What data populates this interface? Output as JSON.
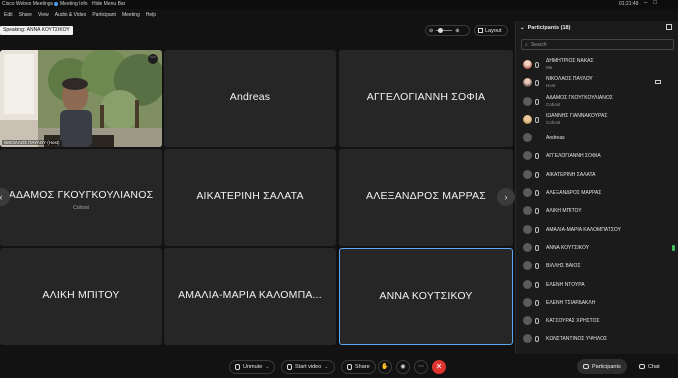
{
  "titlebar": {
    "app_title": "Cisco Webex Meetings",
    "meeting_info": "Meeting Info",
    "hide_menu": "Hide Menu Bar",
    "clock": "01:21:49"
  },
  "menu": [
    "Edit",
    "Share",
    "View",
    "Audio & Video",
    "Participant",
    "Meeting",
    "Help"
  ],
  "speaking_label": "Speaking: ΑΝΝΑ ΚΟΥΤΣΙΚΟΥ",
  "layout_label": "Layout",
  "tiles": [
    {
      "name": "ΝΙΚΟΛΑΟΣ ΠΑΥΛΟΥ (Host)",
      "role": ""
    },
    {
      "name": "Andreas",
      "role": ""
    },
    {
      "name": "ΑΓΓΕΛΟΓΙΑΝΝΗ ΣΟΦΙΑ",
      "role": ""
    },
    {
      "name": "ΑΔΑΜΟΣ ΓΚΟΥΓΚΟΥΛΙΑΝΟΣ",
      "role": "Cohost"
    },
    {
      "name": "ΑΙΚΑΤΕΡΙΝΗ ΣΑΛΑΤΑ",
      "role": ""
    },
    {
      "name": "ΑΛΕΞΑΝΔΡΟΣ ΜΑΡΡΑΣ",
      "role": ""
    },
    {
      "name": "ΑΛΙΚΗ ΜΠΙΤΟΥ",
      "role": ""
    },
    {
      "name": "ΑΜΑΛΙΑ-ΜΑΡΙΑ ΚΑΛΟΜΠΑ...",
      "role": ""
    },
    {
      "name": "ΑΝΝΑ ΚΟΥΤΣΙΚΟΥ",
      "role": ""
    }
  ],
  "participants_panel": {
    "title": "Participants (18)",
    "search_placeholder": "Search",
    "items": [
      {
        "name": "ΔΗΜΗΤΡΙΟΣ ΝΑΚΑΣ",
        "sub": "Me"
      },
      {
        "name": "ΝΙΚΟΛΑΟΣ ΠΑΥΛΟΥ",
        "sub": "Host"
      },
      {
        "name": "ΑΔΑΜΟΣ ΓΚΟΥΓΚΟΥΛΙΑΝΟΣ",
        "sub": "Cohost"
      },
      {
        "name": "ΙΩΑΝΝΗΣ ΓΙΑΝΝΑΚΟΥΡΑΣ",
        "sub": "Cohost"
      },
      {
        "name": "Andreas",
        "sub": ""
      },
      {
        "name": "ΑΓΓΕΛΟΓΙΑΝΝΗ ΣΟΦΙΑ",
        "sub": ""
      },
      {
        "name": "ΑΙΚΑΤΕΡΙΝΗ ΣΑΛΑΤΑ",
        "sub": ""
      },
      {
        "name": "ΑΛΕΞΑΝΔΡΟΣ ΜΑΡΡΑΣ",
        "sub": ""
      },
      {
        "name": "ΑΛΙΚΗ ΜΠΙΤΟΥ",
        "sub": ""
      },
      {
        "name": "ΑΜΑΛΙΑ-ΜΑΡΙΑ ΚΑΛΟΜΠΑΤΣΟΥ",
        "sub": ""
      },
      {
        "name": "ΑΝΝΑ ΚΟΥΤΣΙΚΟΥ",
        "sub": ""
      },
      {
        "name": "ΒΙΛΛΗΣ ΒΑΙΟΣ",
        "sub": ""
      },
      {
        "name": "ΕΛΕΝΗ ΝΤΟΥΡΑ",
        "sub": ""
      },
      {
        "name": "ΕΛΕΝΗ ΤΣΙΑΡΔΑΚΛΗ",
        "sub": ""
      },
      {
        "name": "ΚΑΤΣΟΥΡΑΣ ΧΡΗΣΤΟΣ",
        "sub": ""
      },
      {
        "name": "ΚΩΝΣΤΑΝΤΙΝΟΣ ΥΨΗΛΟΣ",
        "sub": ""
      }
    ]
  },
  "controls": {
    "unmute": "Unmute",
    "start_video": "Start video",
    "share": "Share",
    "participants": "Participants",
    "chat": "Chat"
  },
  "colors": {
    "accent": "#5aa9f5",
    "end_call": "#e0342f",
    "speaking_indicator": "#3fbf5a"
  }
}
